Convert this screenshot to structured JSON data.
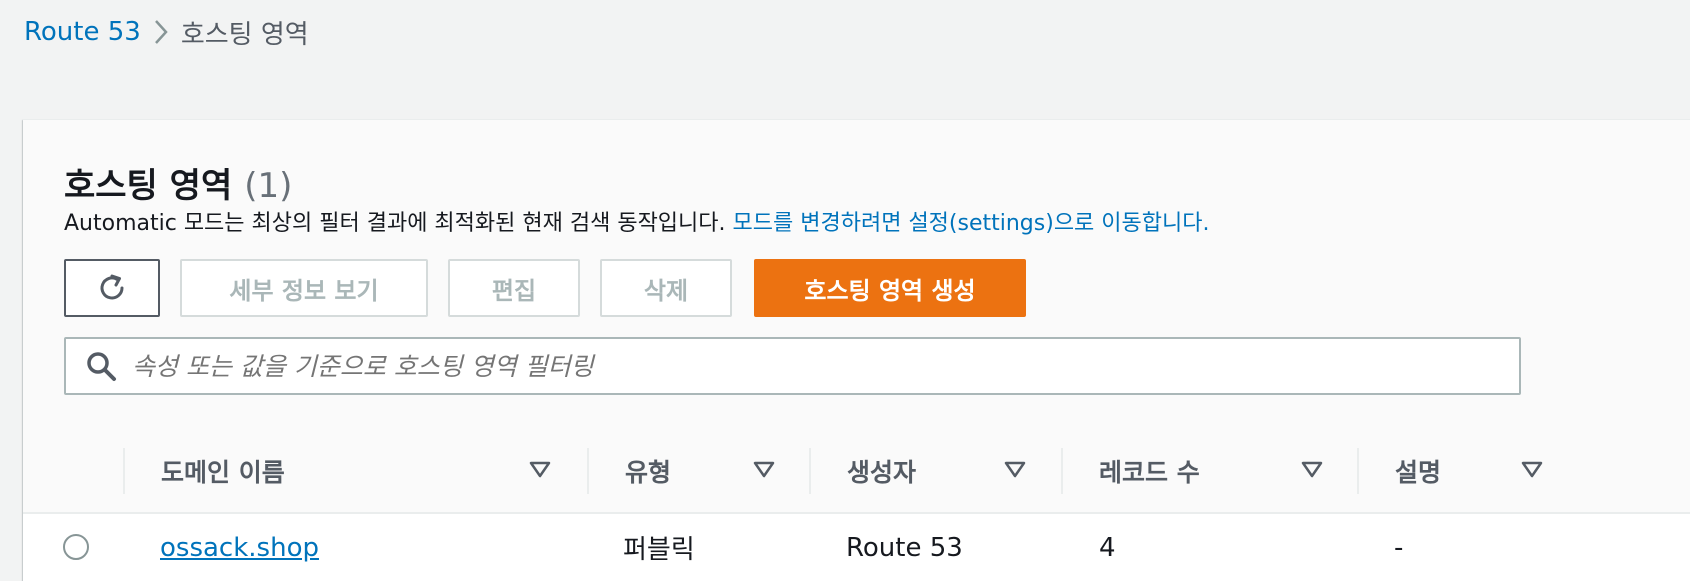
{
  "breadcrumb": {
    "root": "Route 53",
    "current": "호스팅 영역"
  },
  "header": {
    "title": "호스팅 영역",
    "count": "(1)",
    "description": "Automatic 모드는 최상의 필터 결과에 최적화된 현재 검색 동작입니다.",
    "description_link": "모드를 변경하려면 설정(settings)으로 이동합니다."
  },
  "toolbar": {
    "refresh_icon": "refresh-icon",
    "details_label": "세부 정보 보기",
    "edit_label": "편집",
    "delete_label": "삭제",
    "create_label": "호스팅 영역 생성"
  },
  "search": {
    "placeholder": "속성 또는 값을 기준으로 호스팅 영역 필터링",
    "icon": "search-icon"
  },
  "table": {
    "columns": [
      "도메인 이름",
      "유형",
      "생성자",
      "레코드 수",
      "설명"
    ],
    "rows": [
      {
        "domain": "ossack.shop",
        "type": "퍼블릭",
        "created_by": "Route 53",
        "record_count": "4",
        "description": "-"
      }
    ]
  },
  "colors": {
    "link": "#0073bb",
    "primary_button": "#ec7211",
    "text": "#16191f",
    "muted": "#545b64",
    "disabled": "#aab7b8"
  }
}
